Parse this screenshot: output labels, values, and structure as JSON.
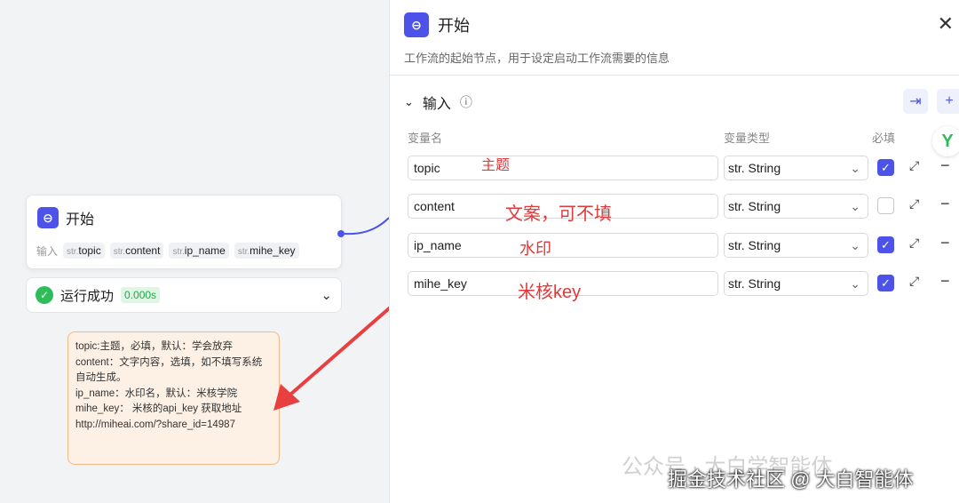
{
  "node": {
    "title": "开始",
    "inputs_label": "输入",
    "type_prefix": "str.",
    "inputs": [
      "topic",
      "content",
      "ip_name",
      "mihe_key"
    ]
  },
  "run": {
    "status": "运行成功",
    "time": "0.000s"
  },
  "note": {
    "lines": [
      "topic:主题，必填，默认：学会放弃",
      "content：文字内容，选填，如不填写系统自动生成。",
      "ip_name：水印名，默认：米核学院",
      "mihe_key： 米核的api_key 获取地址",
      "http://miheai.com/?share_id=14987"
    ]
  },
  "panel": {
    "title": "开始",
    "description": "工作流的起始节点，用于设定启动工作流需要的信息",
    "section": "输入",
    "col_name": "变量名",
    "col_type": "变量类型",
    "col_required": "必填",
    "rows": [
      {
        "name": "topic",
        "type": "str. String",
        "required": true,
        "annotation": "主题"
      },
      {
        "name": "content",
        "type": "str. String",
        "required": false,
        "annotation": "文案，可不填"
      },
      {
        "name": "ip_name",
        "type": "str. String",
        "required": true,
        "annotation": "水印"
      },
      {
        "name": "mihe_key",
        "type": "str. String",
        "required": true,
        "annotation": "米核key"
      }
    ]
  },
  "watermark": {
    "line1": "公众号 · 大白学智能体",
    "line2": "掘金技术社区 @ 大白智能体"
  }
}
